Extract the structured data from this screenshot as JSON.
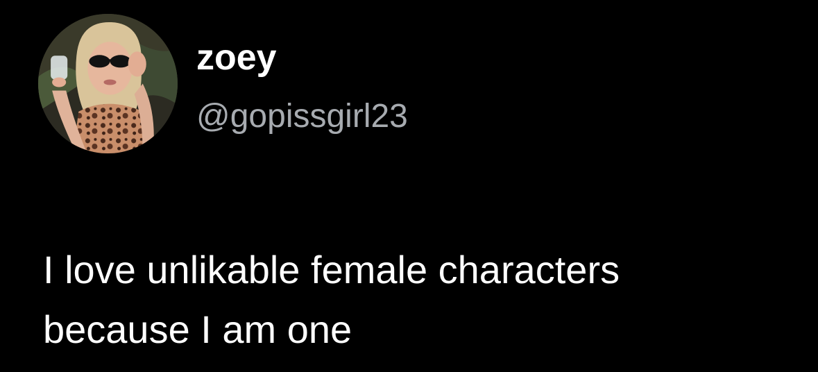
{
  "user": {
    "display_name": "zoey",
    "handle": "@gopissgirl23",
    "avatar_icon": "profile-photo"
  },
  "tweet": {
    "lines": [
      "I love unlikable female characters",
      "because I am one"
    ]
  },
  "colors": {
    "background": "#000000",
    "primary_text": "#ffffff",
    "secondary_text": "#a7abb0"
  }
}
